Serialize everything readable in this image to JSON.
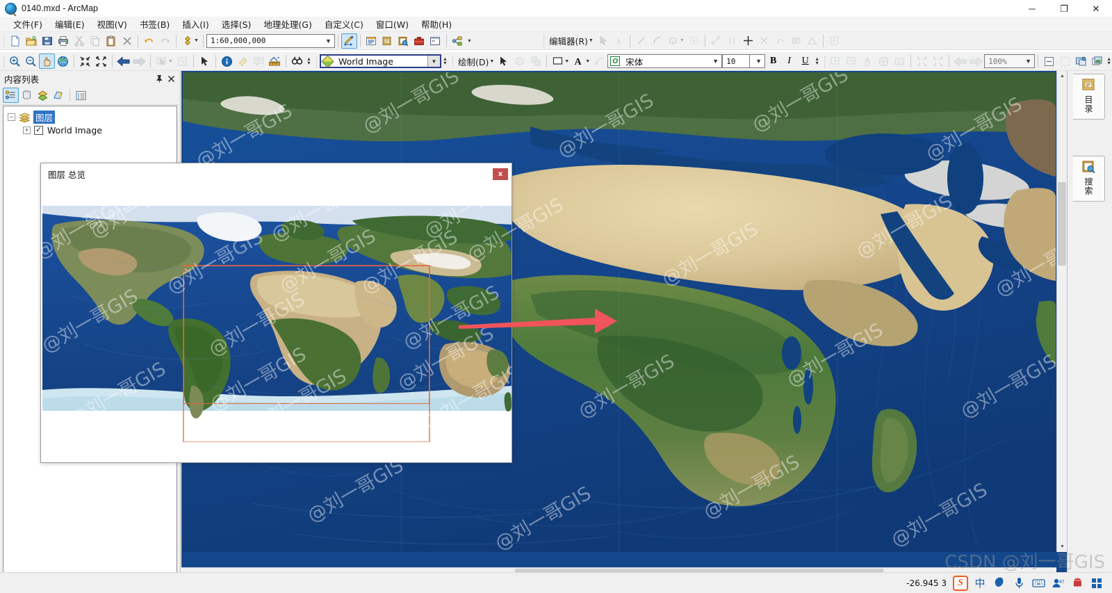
{
  "window": {
    "title": "0140.mxd - ArcMap",
    "app_icon": "arcmap-globe-icon",
    "minimize": "─",
    "restore": "❐",
    "close": "✕"
  },
  "menubar": {
    "items": [
      {
        "label": "文件(F)",
        "name": "menu-file"
      },
      {
        "label": "编辑(E)",
        "name": "menu-edit"
      },
      {
        "label": "视图(V)",
        "name": "menu-view"
      },
      {
        "label": "书签(B)",
        "name": "menu-bookmarks"
      },
      {
        "label": "插入(I)",
        "name": "menu-insert"
      },
      {
        "label": "选择(S)",
        "name": "menu-selection"
      },
      {
        "label": "地理处理(G)",
        "name": "menu-geoprocessing"
      },
      {
        "label": "自定义(C)",
        "name": "menu-customize"
      },
      {
        "label": "窗口(W)",
        "name": "menu-windows"
      },
      {
        "label": "帮助(H)",
        "name": "menu-help"
      }
    ]
  },
  "standard_toolbar": {
    "scale_value": "1:60,000,000",
    "buttons": [
      "new-map-icon",
      "open-icon",
      "save-icon",
      "print-icon",
      "cut-icon",
      "copy-icon",
      "paste-icon",
      "delete-icon",
      "undo-icon",
      "redo-icon",
      "add-data-icon",
      "editor-toolbar-icon",
      "table-of-contents-icon",
      "catalog-icon",
      "search-icon",
      "arctoolbox-icon",
      "python-window-icon",
      "model-builder-icon"
    ]
  },
  "editor_toolbar": {
    "label": "编辑器(R)",
    "buttons": [
      "edit-tool-icon",
      "edit-annotation-icon",
      "straight-segment-icon",
      "arc-segment-icon",
      "construct-polygon-icon",
      "sketch-properties-icon",
      "trace-icon",
      "split-icon",
      "rotate-icon",
      "cut-polygons-icon",
      "reshape-icon",
      "merge-icon",
      "buffer-icon",
      "attributes-icon"
    ]
  },
  "tools_toolbar": {
    "active_tool": "pan-tool",
    "buttons": [
      "zoom-in-icon",
      "zoom-out-icon",
      "pan-icon",
      "full-extent-icon",
      "fixed-zoom-in-icon",
      "fixed-zoom-out-icon",
      "go-back-icon",
      "go-forward-icon",
      "select-features-icon",
      "clear-selection-icon",
      "select-elements-icon",
      "identify-icon",
      "hyperlink-icon",
      "html-popup-icon",
      "measure-icon",
      "find-icon"
    ]
  },
  "draw_toolbar": {
    "layer_value": "World Image",
    "draw_label": "绘制(D)",
    "font_family_value": "宋体",
    "font_size_value": "10",
    "bold": "B",
    "italic": "I",
    "underline": "U",
    "buttons": [
      "select-elements-icon",
      "rotate-element-icon",
      "group-icon",
      "fill-color-icon",
      "text-color-icon",
      "new-text-icon"
    ]
  },
  "layout_toolbar": {
    "zoom_value": "100%",
    "buttons": [
      "layout-zoom-in-icon",
      "layout-zoom-out-icon",
      "layout-pan-icon",
      "layout-full-extent-icon",
      "layout-1to1-icon",
      "fixed-zoom-in-icon",
      "fixed-zoom-out-icon",
      "layout-back-icon",
      "layout-forward-icon",
      "toggle-draft-mode-icon",
      "focus-data-frame-icon",
      "change-layout-icon",
      "data-driven-pages-icon"
    ]
  },
  "toc": {
    "title": "内容列表",
    "pin_icon": "pin-icon",
    "close_icon": "close-icon",
    "tool_buttons": [
      "list-by-drawing-order-icon",
      "list-by-source-icon",
      "list-by-visibility-icon",
      "list-by-selection-icon",
      "options-icon"
    ],
    "tree": {
      "root_label": "图层",
      "root_expander": "−",
      "root_selected": true,
      "children": [
        {
          "label": "World Image",
          "checked": true,
          "expander": "+",
          "check_glyph": "✓"
        }
      ]
    }
  },
  "overview_window": {
    "title": "图层 总览",
    "close_label": "x",
    "extent_rect_color": "#e8673c",
    "arrow_color": "#f2545b"
  },
  "map_view": {
    "view_buttons": [
      "data-view-icon",
      "layout-view-icon",
      "refresh-icon",
      "pause-drawing-icon"
    ],
    "scrollbar_up": "▲",
    "scrollbar_down": "▼"
  },
  "right_dock": {
    "tabs": [
      {
        "label": "目录",
        "name": "dock-tab-catalog",
        "icon": "catalog-icon"
      },
      {
        "label": "搜索",
        "name": "dock-tab-search",
        "icon": "search-icon"
      }
    ]
  },
  "statusbar": {
    "coordinates": "-26.945   3"
  },
  "taskbar": {
    "ime_logo": "S",
    "ime_mode": "中",
    "items": [
      "moon-icon",
      "microphone-icon",
      "keyboard-icon",
      "emoji-icon",
      "toolbox-icon",
      "apps-icon"
    ]
  },
  "watermarks": {
    "text": "@刘一哥GIS",
    "csdn": "CSDN @刘一哥GIS"
  }
}
